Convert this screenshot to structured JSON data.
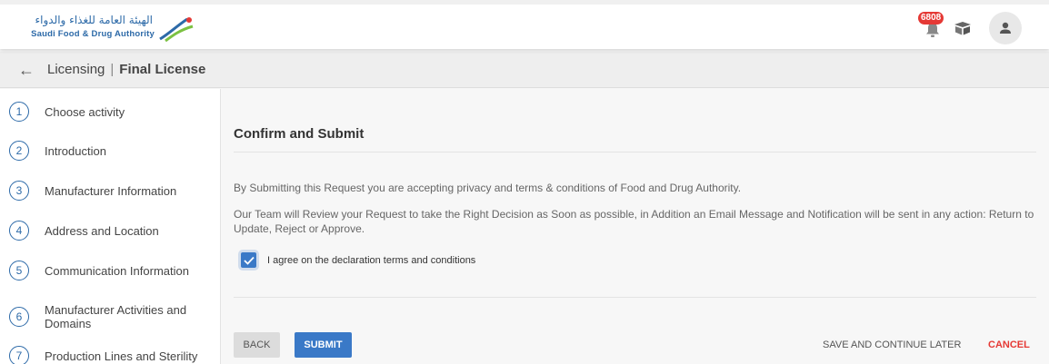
{
  "header": {
    "logo_ar": "الهيئة العامة للغذاء والدواء",
    "logo_en": "Saudi Food & Drug Authority",
    "notification_count": "6808"
  },
  "subheader": {
    "breadcrumb_root": "Licensing",
    "separator": "|",
    "breadcrumb_current": "Final License"
  },
  "steps": [
    {
      "num": "1",
      "label": "Choose activity"
    },
    {
      "num": "2",
      "label": "Introduction"
    },
    {
      "num": "3",
      "label": "Manufacturer Information"
    },
    {
      "num": "4",
      "label": "Address and Location"
    },
    {
      "num": "5",
      "label": "Communication Information"
    },
    {
      "num": "6",
      "label": "Manufacturer Activities and Domains"
    },
    {
      "num": "7",
      "label": "Production Lines and Sterility"
    }
  ],
  "main": {
    "title": "Confirm and Submit",
    "paragraph1": "By Submitting this Request you are accepting privacy and terms & conditions of Food and Drug Authority.",
    "paragraph2": "Our Team will Review your Request to take the Right Decision as Soon as possible, in Addition an Email Message and Notification will be sent in any action: Return to Update, Reject or Approve.",
    "agree_label": "I agree on the declaration terms and conditions",
    "agree_checked": true
  },
  "actions": {
    "back": "BACK",
    "submit": "SUBMIT",
    "save_later": "SAVE AND CONTINUE LATER",
    "cancel": "CANCEL"
  },
  "colors": {
    "primary": "#3a79c7",
    "danger": "#e53935",
    "brand": "#2d6aa8"
  }
}
